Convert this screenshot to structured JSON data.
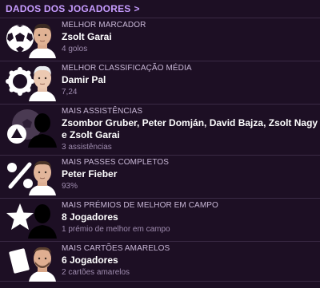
{
  "header": {
    "title": "DADOS DOS JOGADORES",
    "chevron": ">"
  },
  "stats": [
    {
      "label": "MELHOR MARCADOR",
      "name": "Zsolt Garai",
      "value": "4 golos",
      "icon": "soccer-ball-icon"
    },
    {
      "label": "MELHOR CLASSIFICAÇÃO MÉDIA",
      "name": "Damir Pal",
      "value": "7,24",
      "icon": "rating-badge-icon"
    },
    {
      "label": "MAIS ASSISTÊNCIAS",
      "name": "Zsombor Gruber, Peter Domján, David Bajza, Zsolt Nagy e Zsolt Garai",
      "value": "3 assistências",
      "icon": "assist-icon"
    },
    {
      "label": "MAIS PASSES COMPLETOS",
      "name": "Peter Fieber",
      "value": "93%",
      "icon": "percent-icon"
    },
    {
      "label": "MAIS PRÉMIOS DE MELHOR EM CAMPO",
      "name": "8 Jogadores",
      "value": "1 prémio de melhor em campo",
      "icon": "star-icon"
    },
    {
      "label": "MAIS CARTÕES AMARELOS",
      "name": "6 Jogadores",
      "value": "2 cartões amarelos",
      "icon": "yellow-card-icon"
    }
  ]
}
